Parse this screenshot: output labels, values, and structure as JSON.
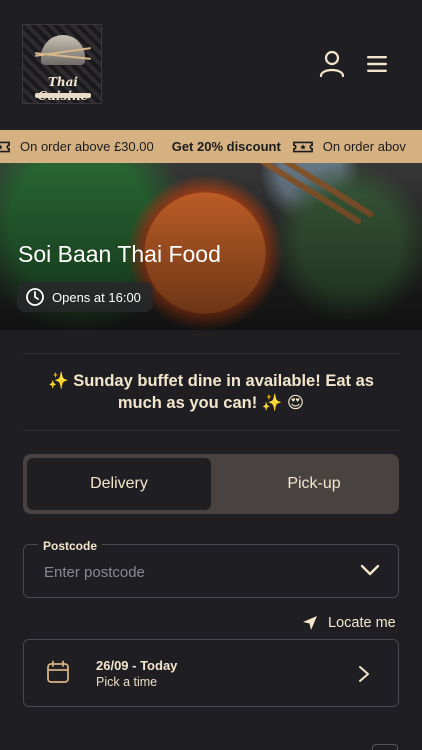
{
  "header": {
    "logo": {
      "brand": "Thai Cuisine"
    },
    "user_icon": "user-icon",
    "menu_icon": "hamburger-menu-icon"
  },
  "promo": {
    "items": [
      {
        "prefix": "On order above £30.00",
        "highlight": "Get 20% discount"
      },
      {
        "prefix": "On order abov",
        "highlight": ""
      }
    ],
    "icon": "ticket-icon",
    "background": "#d6b282"
  },
  "hero": {
    "restaurant_name": "Soi Baan Thai Food",
    "opening": "Opens at 16:00",
    "opening_icon": "clock-icon"
  },
  "announcement": {
    "text": "✨ Sunday buffet dine in available! Eat as much as you can! ✨ 😍"
  },
  "order_type": {
    "options": [
      "Delivery",
      "Pick-up"
    ],
    "selected": "Delivery"
  },
  "postcode": {
    "label": "Postcode",
    "placeholder": "Enter postcode",
    "value": ""
  },
  "locate": {
    "label": "Locate me",
    "icon": "location-arrow-icon"
  },
  "time": {
    "date": "26/09 - Today",
    "sub": "Pick a time",
    "icon": "calendar-icon"
  },
  "colors": {
    "background": "#1f1e22",
    "text": "#f3e6cc",
    "accent": "#d6b282",
    "toggle_track": "#484340"
  }
}
